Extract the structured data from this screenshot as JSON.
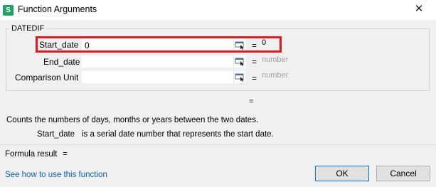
{
  "window": {
    "title": "Function Arguments",
    "close_glyph": "✕",
    "app_icon_letter": "S"
  },
  "function": {
    "name": "DATEDIF",
    "description": "Counts the numbers of days, months or years between the two dates."
  },
  "arguments": [
    {
      "label": "Start_date",
      "value": "0",
      "result": "0"
    },
    {
      "label": "End_date",
      "value": "",
      "result": "number"
    },
    {
      "label": "Comparison Unit",
      "value": "",
      "result": "number"
    }
  ],
  "equals_sign": "=",
  "argument_help": {
    "name": "Start_date",
    "text": "is a serial date number that represents the start date."
  },
  "formula_result": {
    "label": "Formula result",
    "eq": "="
  },
  "help_link": "See how to use this function",
  "buttons": {
    "ok": "OK",
    "cancel": "Cancel"
  },
  "colors": {
    "highlight": "#e8171e",
    "link": "#0b62b0",
    "app_icon": "#21a366"
  }
}
